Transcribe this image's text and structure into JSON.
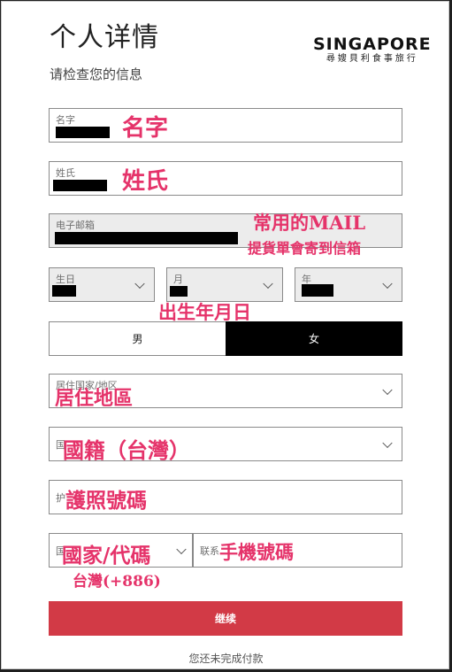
{
  "header": {
    "title": "个人详情",
    "subtitle": "请检查您的信息",
    "logo_main": "SINGAPORE",
    "logo_sub": "尋嫂貝利食事旅行"
  },
  "fields": {
    "first_name_label": "名字",
    "last_name_label": "姓氏",
    "email_label": "电子邮箱",
    "day_label": "生日",
    "month_label": "月",
    "year_label": "年",
    "residence_placeholder": "居住国家/地区",
    "nationality_placeholder": "国",
    "passport_placeholder": "护",
    "country_code_placeholder": "国",
    "phone_placeholder": "联系"
  },
  "gender": {
    "male": "男",
    "female": "女",
    "selected": "female"
  },
  "annotations": {
    "first_name": "名字",
    "last_name": "姓氏",
    "email_main": "常用的MAIL",
    "email_sub": "提貨單會寄到信箱",
    "birthday": "出生年月日",
    "residence": "居住地區",
    "nationality": "國籍（台灣）",
    "passport": "護照號碼",
    "country_code": "國家/代碼",
    "country_code_value": "台灣(+886)",
    "phone": "手機號碼",
    "color": "#e5336a"
  },
  "actions": {
    "continue": "继续",
    "footer_note": "您还未完成付款",
    "continue_color": "#d23a46"
  }
}
